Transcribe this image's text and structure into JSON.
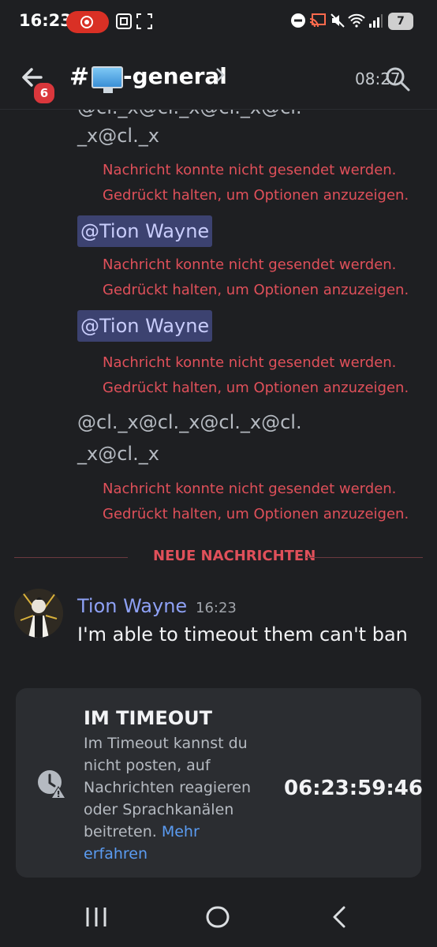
{
  "status_bar": {
    "time": "16:23",
    "battery": "7"
  },
  "header": {
    "unread_count": "6",
    "channel_prefix": "#",
    "channel_icon": "desktop-computer-emoji",
    "channel_name": "-general",
    "time": "08:27"
  },
  "messages": {
    "partial_top_line": "@cl._x@cl._x@cl._x@cl.",
    "group1_line2": "_x@cl._x",
    "error_line1": "Nachricht konnte nicht gesendet werden.",
    "error_line2": "Gedrückt halten, um Optionen anzuzeigen.",
    "mention1": "@Tion Wayne",
    "mention2": "@Tion Wayne",
    "group4_line1": "@cl._x@cl._x@cl._x@cl.",
    "group4_line2": "_x@cl._x"
  },
  "divider": {
    "label": "NEUE NACHRICHTEN"
  },
  "new_message": {
    "author": "Tion Wayne",
    "time": "16:23",
    "text": "I'm able to timeout them can't ban"
  },
  "timeout_card": {
    "title": "IM TIMEOUT",
    "body": "Im Timeout kannst du nicht posten, auf Nachrichten reagieren oder Sprachkanälen beitreten.",
    "link": "Mehr erfahren",
    "countdown": "06:23:59:46"
  },
  "colors": {
    "background": "#1e1f22",
    "error": "#e0505a",
    "mention_bg": "#3c4270",
    "author": "#8ea1f5",
    "link": "#5b9cf2",
    "card": "#2b2d31"
  }
}
